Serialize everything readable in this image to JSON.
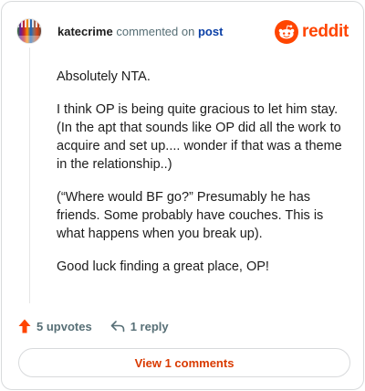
{
  "header": {
    "username": "katecrime",
    "action_text": "commented on",
    "post_link": "post",
    "brand_word": "reddit"
  },
  "comment": {
    "paragraphs": [
      "Absolutely NTA.",
      "I think OP is being quite gracious to let him stay. (In the apt that sounds like OP did all the work to acquire and set up.... wonder if that was a theme in the relationship..)",
      "(“Where would BF go?” Presumably he has friends. Some probably have couches. This is what happens when you break up).",
      "Good luck finding a great place, OP!"
    ]
  },
  "actions": {
    "upvotes_label": "5 upvotes",
    "reply_label": "1 reply"
  },
  "footer": {
    "view_comments_label": "View 1 comments"
  },
  "icons": {
    "avatar": "user-avatar",
    "brand": "reddit-snoo-icon",
    "upvote": "upvote-arrow-icon",
    "reply": "reply-arrow-icon"
  },
  "colors": {
    "brand": "#ff4500",
    "upvote": "#ff4500",
    "link": "#0a3fa6",
    "view_button_text": "#d93a00"
  }
}
